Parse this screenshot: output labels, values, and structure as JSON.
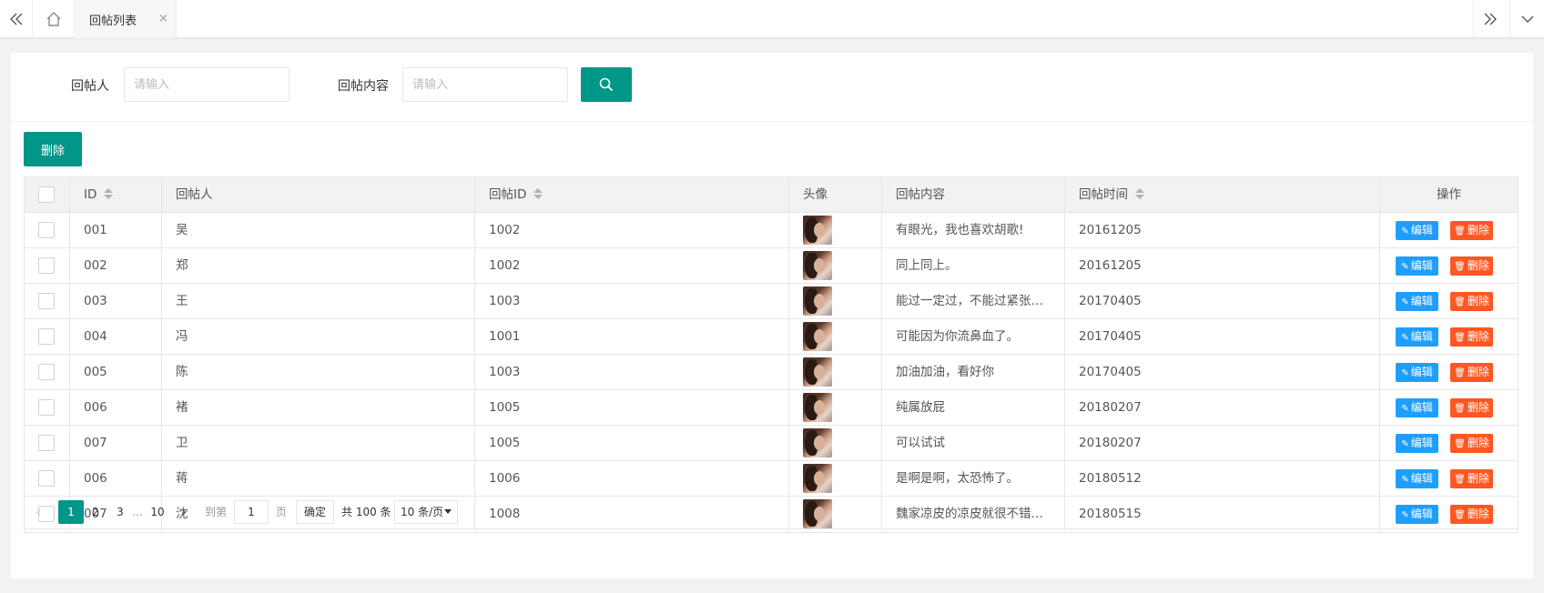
{
  "topbar": {
    "tab_label": "回帖列表",
    "tab_close": "×"
  },
  "search": {
    "poster_label": "回帖人",
    "poster_placeholder": "请输入",
    "content_label": "回帖内容",
    "content_placeholder": "请输入"
  },
  "toolbar": {
    "delete_label": "删除"
  },
  "table": {
    "headers": [
      "ID",
      "回帖人",
      "回帖ID",
      "头像",
      "回帖内容",
      "回帖时间",
      "操作"
    ],
    "edit_label": "编辑",
    "delete_label": "删除",
    "rows": [
      {
        "id": "001",
        "poster": "吴",
        "reply_id": "1002",
        "content": "有眼光，我也喜欢胡歌!",
        "time": "20161205"
      },
      {
        "id": "002",
        "poster": "郑",
        "reply_id": "1002",
        "content": "同上同上。",
        "time": "20161205"
      },
      {
        "id": "003",
        "poster": "王",
        "reply_id": "1003",
        "content": "能过一定过，不能过紧张…",
        "time": "20170405"
      },
      {
        "id": "004",
        "poster": "冯",
        "reply_id": "1001",
        "content": "可能因为你流鼻血了。",
        "time": "20170405"
      },
      {
        "id": "005",
        "poster": "陈",
        "reply_id": "1003",
        "content": "加油加油，看好你",
        "time": "20170405"
      },
      {
        "id": "006",
        "poster": "褚",
        "reply_id": "1005",
        "content": "纯属放屁",
        "time": "20180207"
      },
      {
        "id": "007",
        "poster": "卫",
        "reply_id": "1005",
        "content": "可以试试",
        "time": "20180207"
      },
      {
        "id": "006",
        "poster": "蒋",
        "reply_id": "1006",
        "content": "是啊是啊，太恐怖了。",
        "time": "20180512"
      },
      {
        "id": "007",
        "poster": "沈",
        "reply_id": "1008",
        "content": "魏家凉皮的凉皮就很不错…",
        "time": "20180515"
      }
    ]
  },
  "pager": {
    "current": "1",
    "p2": "2",
    "p3": "3",
    "ellipsis": "…",
    "last": "10",
    "goto_label": "到第",
    "goto_value": "1",
    "page_unit": "页",
    "confirm": "确定",
    "total": "共 100 条",
    "per_page": "10 条/页"
  },
  "colors": {
    "primary": "#009688",
    "edit": "#1e9fff",
    "danger": "#ff5722"
  }
}
